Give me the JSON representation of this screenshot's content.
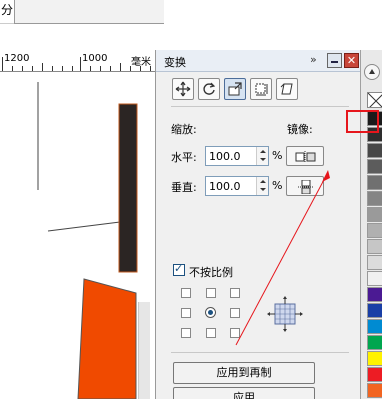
{
  "menu": {
    "fragment": "分"
  },
  "ruler": {
    "labels": [
      "1200",
      "1000",
      "毫米"
    ]
  },
  "docker": {
    "title": "变换",
    "title_arrows": "»",
    "close_glyph": "✕",
    "mode_icons": [
      "position-icon",
      "rotate-icon",
      "scale-mirror-icon",
      "size-icon",
      "skew-icon"
    ],
    "scale_label": "缩放:",
    "mirror_label": "镜像:",
    "horizontal_label": "水平:",
    "horizontal_value": "100.0",
    "vertical_label": "垂直:",
    "vertical_value": "100.0",
    "percent": "%",
    "nonproportional_label": "不按比例",
    "nonproportional_checked": true,
    "apply_to_duplicate": "应用到再制",
    "apply": "应用"
  },
  "palette": {
    "colors": [
      "#1a1a1a",
      "#2e2e2e",
      "#474747",
      "#5c5c5c",
      "#707070",
      "#858585",
      "#9a9a9a",
      "#b0b0b0",
      "#c6c6c6",
      "#dcdcdc",
      "#f0f0f0",
      "#4b1a93",
      "#1a3fa6",
      "#008bd2",
      "#00a64f",
      "#fff200",
      "#ed1c24",
      "#f26522"
    ]
  },
  "colors": {
    "accent_red": "#e6161c",
    "object_orange": "#f04a00",
    "object_dark": "#2b2523"
  }
}
